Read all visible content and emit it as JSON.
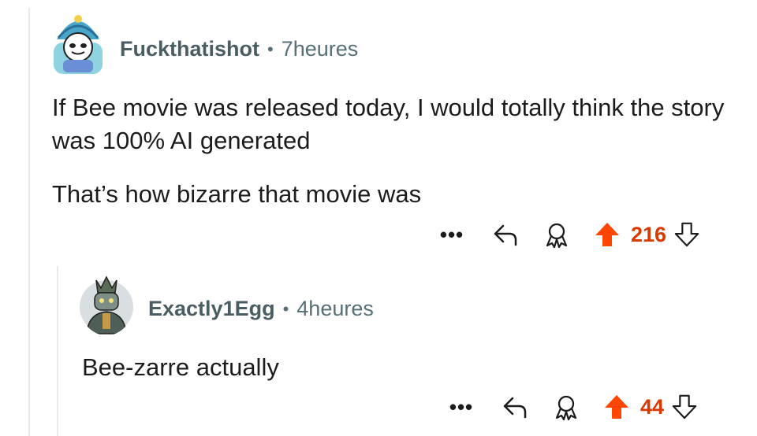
{
  "comment": {
    "username": "Fuckthatishot",
    "separator": "•",
    "time": "7heures",
    "paragraphs": [
      "If Bee movie was released today, I would totally think the story was 100% AI generated",
      "That’s how bizarre that movie was"
    ],
    "more_label": "•••",
    "score": "216"
  },
  "reply": {
    "username": "Exactly1Egg",
    "separator": "•",
    "time": "4heures",
    "text": "Bee-zarre actually",
    "more_label": "•••",
    "score": "44"
  },
  "colors": {
    "upvote": "#ff4500",
    "score": "#d93a00",
    "muted": "#576f76",
    "text": "#1c1c1c"
  },
  "icons": {
    "reply": "reply-arrow-icon",
    "award": "award-icon",
    "upvote": "upvote-arrow-icon",
    "downvote": "downvote-arrow-icon"
  }
}
